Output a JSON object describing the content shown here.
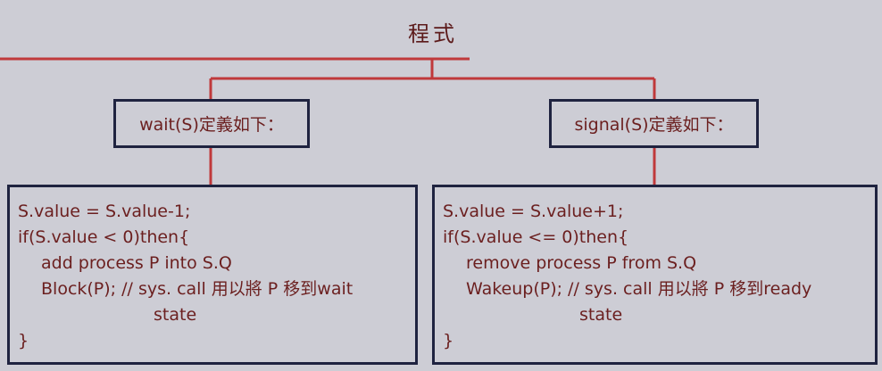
{
  "diagram": {
    "title": "程式",
    "left": {
      "label": "wait(S)定義如下：",
      "code": [
        "S.value = S.value-1;",
        "if(S.value < 0)then{",
        "add process P into S.Q",
        "Block(P); // sys. call 用以將 P 移到wait",
        "state",
        "}"
      ]
    },
    "right": {
      "label": "signal(S)定義如下：",
      "code": [
        "S.value = S.value+1;",
        "if(S.value <= 0)then{",
        "remove process P from S.Q",
        "Wakeup(P); // sys. call 用以將 P 移到ready",
        "state",
        "}"
      ]
    },
    "colors": {
      "background": "#cdcdd5",
      "connector": "#c0393b",
      "box_border": "#1f2340",
      "text": "#6b1f1f"
    }
  }
}
